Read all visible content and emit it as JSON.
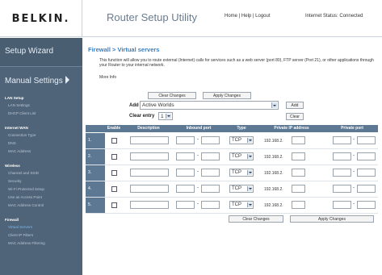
{
  "header": {
    "logo": "BELKIN.",
    "title": "Router Setup Utility",
    "links": [
      "Home",
      "Help",
      "Logout"
    ],
    "status_label": "Internet Status:",
    "status_value": "Connected"
  },
  "sidebar": {
    "setup_wizard": "Setup Wizard",
    "manual_settings": "Manual Settings",
    "sections": [
      {
        "title": "LAN Setup",
        "items": [
          "LAN Settings",
          "DHCP Client List"
        ]
      },
      {
        "title": "Internet WAN",
        "items": [
          "Connection Type",
          "DNS",
          "MAC Address"
        ]
      },
      {
        "title": "Wireless",
        "items": [
          "Channel and SSID",
          "Security",
          "Wi-Fi Protected Setup",
          "Use as Access Point",
          "MAC Address Control"
        ]
      },
      {
        "title": "Firewall",
        "items": [
          "Virtual Servers",
          "Client IP Filters",
          "MAC Address Filtering"
        ]
      }
    ],
    "active_item": "Virtual Servers"
  },
  "page": {
    "breadcrumb": "Firewall > Virtual servers",
    "description": "This function will allow you to route external (Internet) calls for services such as a web server (port 80), FTP server (Port 21), or other applications through your Router to your internal network.",
    "more_info": "More Info",
    "clear_changes": "Clear Changes",
    "apply_changes": "Apply Changes",
    "add_label": "Add",
    "add_select_value": "Active Worlds",
    "add_button": "Add",
    "clear_entry_label": "Clear entry",
    "clear_entry_value": "1",
    "clear_button": "Clear"
  },
  "table": {
    "headers": [
      "Enable",
      "Description",
      "Inbound port",
      "Type",
      "Private IP address",
      "Private port"
    ],
    "rows": [
      {
        "num": "1.",
        "type": "TCP",
        "ip": "192.168.2."
      },
      {
        "num": "2.",
        "type": "TCP",
        "ip": "192.168.2."
      },
      {
        "num": "3.",
        "type": "TCP",
        "ip": "192.168.2."
      },
      {
        "num": "4.",
        "type": "TCP",
        "ip": "192.168.2."
      },
      {
        "num": "5.",
        "type": "TCP",
        "ip": "192.168.2."
      }
    ],
    "separator": "-"
  }
}
